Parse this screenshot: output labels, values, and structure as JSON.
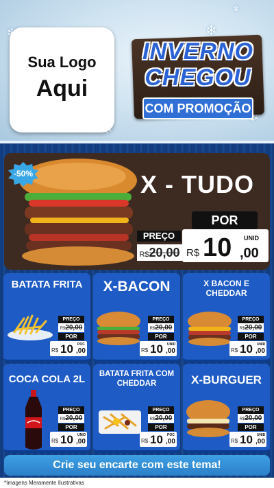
{
  "header": {
    "logo_line1": "Sua Logo",
    "logo_line2": "Aqui",
    "sign_line1": "INVERNO",
    "sign_line2": "CHEGOU",
    "sign_line3": "COM PROMOÇÃO"
  },
  "featured": {
    "badge": "-50%",
    "title": "X - TUDO",
    "por_label": "POR",
    "preco_label": "PREÇO",
    "old_currency": "R$",
    "old_value": "20,00",
    "currency": "R$",
    "price_int": "10",
    "price_dec": ",00",
    "unit": "UNID"
  },
  "products": [
    {
      "title": "BATATA FRITA",
      "preco_label": "PREÇO",
      "old_currency": "R$",
      "old_value": "20,00",
      "por_label": "POR",
      "currency": "R$",
      "price_int": "10",
      "price_dec": ",00",
      "unit": "POC"
    },
    {
      "title": "X-BACON",
      "preco_label": "PREÇO",
      "old_currency": "R$",
      "old_value": "20,00",
      "por_label": "POR",
      "currency": "R$",
      "price_int": "10",
      "price_dec": ",00",
      "unit": "UNID"
    },
    {
      "title": "X BACON E CHEDDAR",
      "preco_label": "PREÇO",
      "old_currency": "R$",
      "old_value": "20,00",
      "por_label": "POR",
      "currency": "R$",
      "price_int": "10",
      "price_dec": ",00",
      "unit": "UNID"
    },
    {
      "title": "COCA COLA 2L",
      "preco_label": "PREÇO",
      "old_currency": "R$",
      "old_value": "20,00",
      "por_label": "POR",
      "currency": "R$",
      "price_int": "10",
      "price_dec": ",00",
      "unit": "UNID"
    },
    {
      "title": "BATATA FRITA COM CHEDDAR",
      "preco_label": "PREÇO",
      "old_currency": "R$",
      "old_value": "20,00",
      "por_label": "POR",
      "currency": "R$",
      "price_int": "10",
      "price_dec": ",00",
      "unit": "POC"
    },
    {
      "title": "X-BURGUER",
      "preco_label": "PREÇO",
      "old_currency": "R$",
      "old_value": "20,00",
      "por_label": "POR",
      "currency": "R$",
      "price_int": "10",
      "price_dec": ",00",
      "unit": "UNID"
    }
  ],
  "cta": "Crie seu encarte com este tema!",
  "footnote": "*Imagens Meramente Ilustrativas",
  "icons": {
    "snowflake": "snowflake-icon"
  },
  "colors": {
    "primary_blue": "#1e5bc4",
    "accent_blue": "#39a6e6",
    "wood_brown": "#3d2a20"
  }
}
